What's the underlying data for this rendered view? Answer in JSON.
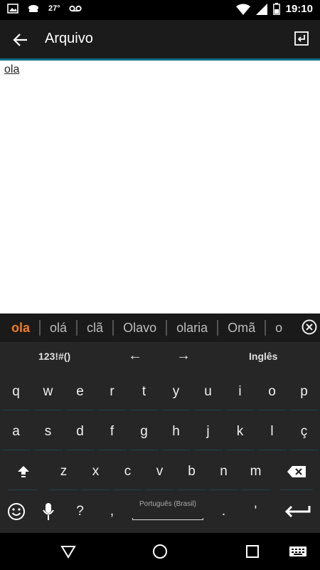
{
  "status_bar": {
    "temperature": "27°",
    "time": "19:10",
    "icons": [
      "image-icon",
      "cloud-icon",
      "voicemail-icon",
      "wifi-icon",
      "battery-icon"
    ]
  },
  "app_bar": {
    "title": "Arquivo"
  },
  "editor": {
    "text": "ola"
  },
  "keyboard": {
    "suggestions": [
      "ola",
      "olá",
      "clã",
      "Olavo",
      "olaria",
      "Omã",
      "o"
    ],
    "toolbar": {
      "symbols_label": "123!#()",
      "left_arrow": "←",
      "right_arrow": "→",
      "language_label": "Inglês"
    },
    "row1": [
      "q",
      "w",
      "e",
      "r",
      "t",
      "y",
      "u",
      "i",
      "o",
      "p"
    ],
    "row2": [
      "a",
      "s",
      "d",
      "f",
      "g",
      "h",
      "j",
      "k",
      "l",
      "ç"
    ],
    "row3": [
      "z",
      "x",
      "c",
      "v",
      "b",
      "n",
      "m"
    ],
    "bottom": {
      "question": "?",
      "comma": ",",
      "space_label": "Português (Brasil)",
      "period": ".",
      "apostrophe": "'"
    }
  },
  "colors": {
    "accent": "#0d6f88",
    "suggestion_highlight": "#f07b1f"
  }
}
